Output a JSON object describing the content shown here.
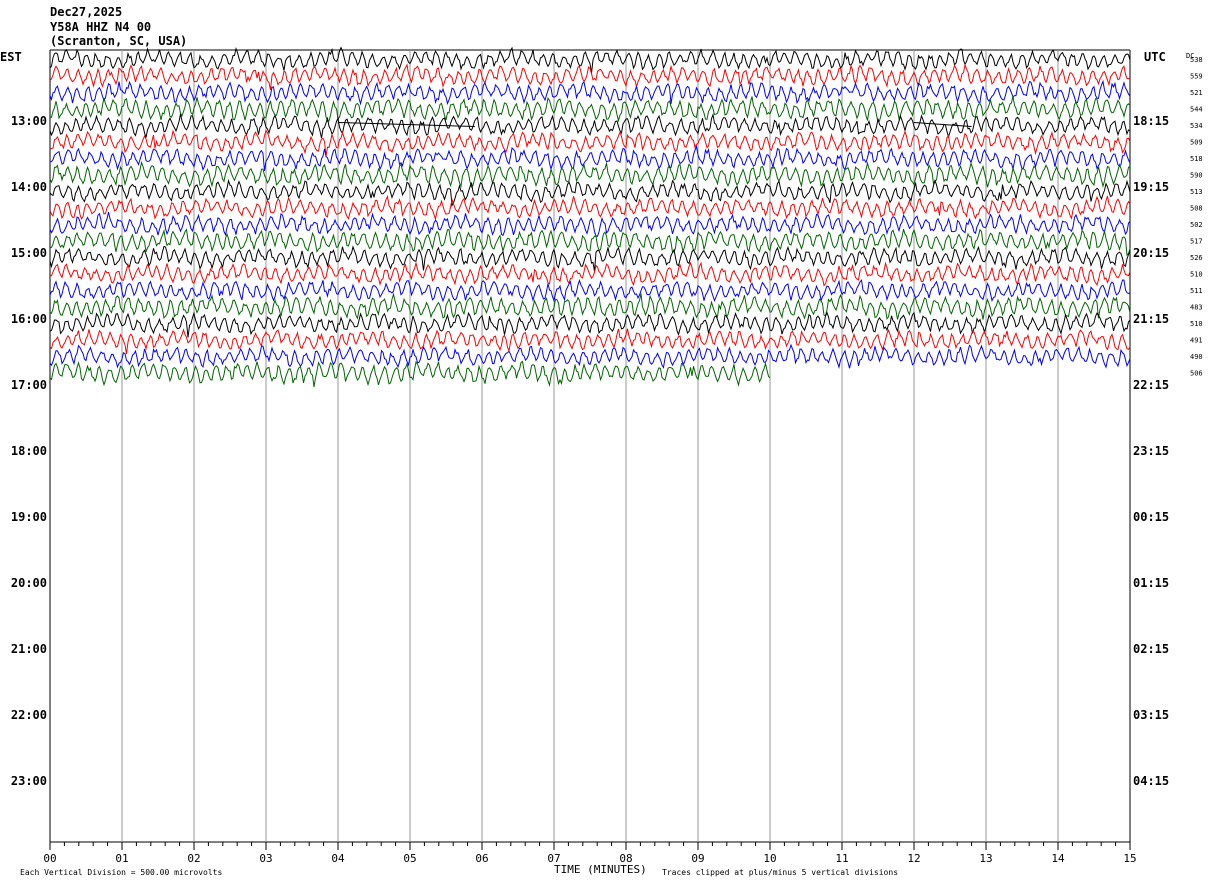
{
  "header": {
    "date": "Dec27,2025",
    "station": "Y58A HHZ N4 00",
    "location": "(Scranton, SC, USA)"
  },
  "labels": {
    "left_timezone": "EST",
    "right_timezone": "UTC",
    "dc_header": "DC",
    "x_axis_title": "TIME (MINUTES)",
    "scale_note": "Each Vertical Division =  500.00 microvolts",
    "clip_note": "Traces clipped at plus/minus 5 vertical divisions"
  },
  "chart_data": {
    "type": "line",
    "title": "Y58A HHZ N4 00",
    "xlabel": "TIME (MINUTES)",
    "xlim": [
      0,
      15
    ],
    "x_ticks": [
      "00",
      "01",
      "02",
      "03",
      "04",
      "05",
      "06",
      "07",
      "08",
      "09",
      "10",
      "11",
      "12",
      "13",
      "14",
      "15"
    ],
    "y_left_hour_labels": [
      "13:00",
      "14:00",
      "15:00",
      "16:00",
      "17:00",
      "18:00",
      "19:00",
      "20:00",
      "21:00",
      "22:00",
      "23:00"
    ],
    "y_right_hour_labels": [
      "18:15",
      "19:15",
      "20:15",
      "21:15",
      "22:15",
      "23:15",
      "00:15",
      "01:15",
      "02:15",
      "03:15",
      "04:15"
    ],
    "total_rows": 48,
    "trace_colors": [
      "#000000",
      "#ff0000",
      "#0000ff",
      "#006600"
    ],
    "dc_offsets": [
      538,
      559,
      521,
      544,
      534,
      509,
      518,
      590,
      513,
      508,
      502,
      517,
      526,
      510,
      511,
      483,
      510,
      491,
      490,
      506
    ],
    "last_row_minutes": 10.0,
    "gap_segments": [
      {
        "row": 4,
        "start_min": 4.0,
        "end_min": 5.9
      },
      {
        "row": 4,
        "start_min": 12.0,
        "end_min": 12.8
      }
    ],
    "scale_microvolts_per_division": 500.0,
    "clip_divisions": 5
  }
}
